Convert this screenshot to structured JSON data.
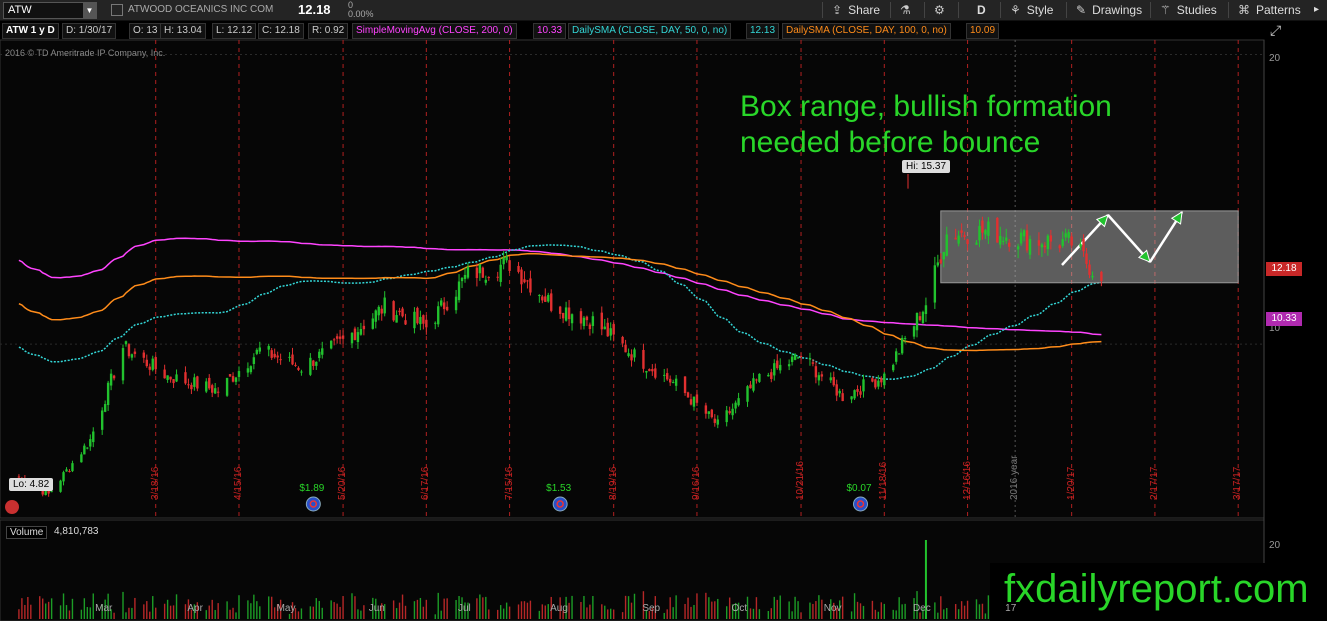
{
  "toolbar": {
    "symbol": "ATW",
    "company": "ATWOOD OCEANICS INC COM",
    "last": "12.18",
    "change": "0",
    "change_pct": "0.00%",
    "share": "Share",
    "period": "D",
    "style": "Style",
    "drawings": "Drawings",
    "studies": "Studies",
    "patterns": "Patterns"
  },
  "infobar": {
    "title": "ATW 1 y D",
    "date": "D: 1/30/17",
    "open": "O: 13",
    "high": "H: 13.04",
    "low": "L: 12.12",
    "close": "C: 12.18",
    "range": "R: 0.92",
    "sma200_label": "SimpleMovingAvg (CLOSE, 200, 0)",
    "sma200_val": "10.33",
    "sma50_label": "DailySMA (CLOSE, DAY, 50, 0, no)",
    "sma50_val": "12.13",
    "sma100_label": "DailySMA (CLOSE, DAY, 100, 0, no)",
    "sma100_val": "10.09",
    "copyright": "2016 © TD Ameritrade IP Company, Inc."
  },
  "annotation": {
    "line1": "Box range, bullish formation",
    "line2": "needed before bounce"
  },
  "watermark": "fxdailyreport.com",
  "volume": {
    "label": "Volume",
    "value": "4,810,783"
  },
  "colors": {
    "up": "#22c22e",
    "down": "#e23030",
    "sma200": "#ff44ff",
    "sma50": "#33d6d6",
    "sma100": "#ff8c1a",
    "annotation": "#29d629",
    "box": "#c8c8c8",
    "event_line": "#b02020"
  },
  "chart_data": {
    "type": "candlestick",
    "title": "ATW 1 y D",
    "ylim": [
      4,
      20.5
    ],
    "price_ticks": [
      "20",
      "10"
    ],
    "right_labels": [
      "12.18",
      "10.33"
    ],
    "hi_label": "Hi: 15.37",
    "lo_label": "Lo: 4.82",
    "month_labels": [
      "Mar",
      "Apr",
      "May",
      "Jun",
      "Jul",
      "Aug",
      "Sep",
      "Oct",
      "Nov",
      "Dec",
      "17"
    ],
    "event_dates": [
      "3/18/16",
      "4/15/16",
      "5/20/16",
      "6/17/16",
      "7/15/16",
      "8/19/16",
      "9/16/16",
      "10/21/16",
      "11/18/16",
      "12/16/16",
      "1/20/17",
      "2/17/17",
      "3/17/17"
    ],
    "year_marker": "2016 year",
    "dividends": [
      "$1.89",
      "$1.53",
      "$0.07"
    ],
    "close_series": [
      {
        "date": "2016-02-01",
        "close": 5.4
      },
      {
        "date": "2016-02-11",
        "close": 4.82
      },
      {
        "date": "2016-02-25",
        "close": 6.7
      },
      {
        "date": "2016-03-07",
        "close": 9.9
      },
      {
        "date": "2016-03-22",
        "close": 8.9
      },
      {
        "date": "2016-04-08",
        "close": 8.4
      },
      {
        "date": "2016-04-22",
        "close": 9.8
      },
      {
        "date": "2016-05-06",
        "close": 9.2
      },
      {
        "date": "2016-05-20",
        "close": 10.1
      },
      {
        "date": "2016-06-03",
        "close": 11.3
      },
      {
        "date": "2016-06-17",
        "close": 10.6
      },
      {
        "date": "2016-07-01",
        "close": 12.4
      },
      {
        "date": "2016-07-15",
        "close": 12.8
      },
      {
        "date": "2016-07-29",
        "close": 11.4
      },
      {
        "date": "2016-08-12",
        "close": 10.8
      },
      {
        "date": "2016-08-26",
        "close": 9.6
      },
      {
        "date": "2016-09-09",
        "close": 8.6
      },
      {
        "date": "2016-09-23",
        "close": 7.2
      },
      {
        "date": "2016-10-07",
        "close": 8.8
      },
      {
        "date": "2016-10-21",
        "close": 9.6
      },
      {
        "date": "2016-11-04",
        "close": 8.2
      },
      {
        "date": "2016-11-18",
        "close": 8.9
      },
      {
        "date": "2016-12-02",
        "close": 11.4
      },
      {
        "date": "2016-12-09",
        "close": 13.8
      },
      {
        "date": "2016-12-23",
        "close": 13.9
      },
      {
        "date": "2017-01-06",
        "close": 13.6
      },
      {
        "date": "2017-01-20",
        "close": 13.5
      },
      {
        "date": "2017-01-30",
        "close": 12.18
      }
    ],
    "sma200_final": 10.33,
    "sma50_final": 12.13,
    "sma100_final": 10.09,
    "box_range": [
      12.12,
      14.6
    ],
    "volume_ylim": [
      0,
      20
    ],
    "volume_tick": "20"
  }
}
